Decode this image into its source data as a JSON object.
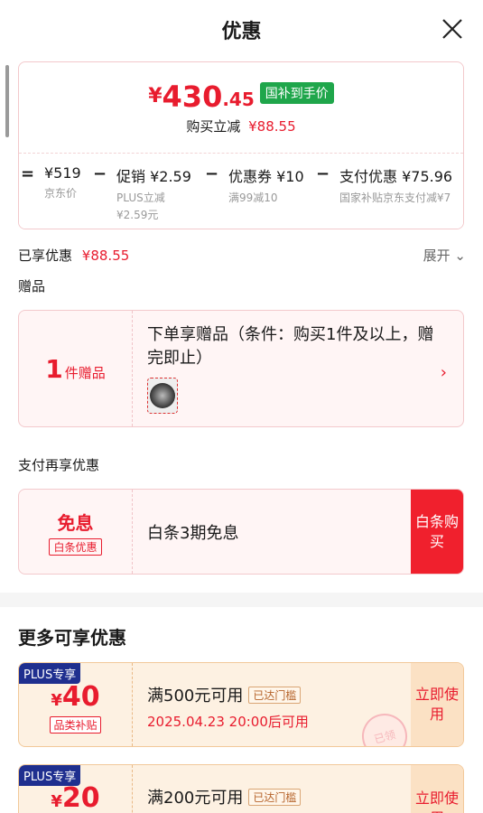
{
  "header": {
    "title": "优惠"
  },
  "price": {
    "yen": "¥",
    "integer": "430",
    "decimal": ".45",
    "badge": "国补到手价",
    "reduce_label": "购买立减",
    "reduce_value": "¥88.55"
  },
  "breakdown": [
    {
      "op": "=",
      "value": "¥519",
      "sub1": "京东价",
      "sub2": ""
    },
    {
      "op": "−",
      "value": "促销 ¥2.59",
      "sub1": "PLUS立减",
      "sub2": "¥2.59元"
    },
    {
      "op": "−",
      "value": "优惠券 ¥10",
      "sub1": "满99减10",
      "sub2": ""
    },
    {
      "op": "−",
      "value": "支付优惠 ¥75.96",
      "sub1": "国家补贴京东支付减¥7",
      "sub2": ""
    }
  ],
  "enjoyed": {
    "label": "已享优惠",
    "value": "¥88.55",
    "expand": "展开 ⌄"
  },
  "gift": {
    "section": "赠品",
    "count": "1",
    "unit": "件赠品",
    "desc": "下单享赠品（条件：购买1件及以上，赠完即止）",
    "chevron": "›"
  },
  "pay": {
    "section": "支付再享优惠",
    "title": "免息",
    "tag": "白条优惠",
    "desc": "白条3期免息",
    "button": "白条购买"
  },
  "more": {
    "title": "更多可享优惠",
    "coupons": [
      {
        "plus": "PLUS专享",
        "yen": "¥",
        "amount": "40",
        "tag": "品类补贴",
        "cond": "满500元可用",
        "reach": "已达门槛",
        "time": "2025.04.23 20:00后可用",
        "button": "立即使用",
        "stamp": "已领"
      },
      {
        "plus": "PLUS专享",
        "yen": "¥",
        "amount": "20",
        "tag": "",
        "cond": "满200元可用",
        "reach": "已达门槛",
        "time": "",
        "button": "立即使用",
        "stamp": ""
      }
    ]
  }
}
